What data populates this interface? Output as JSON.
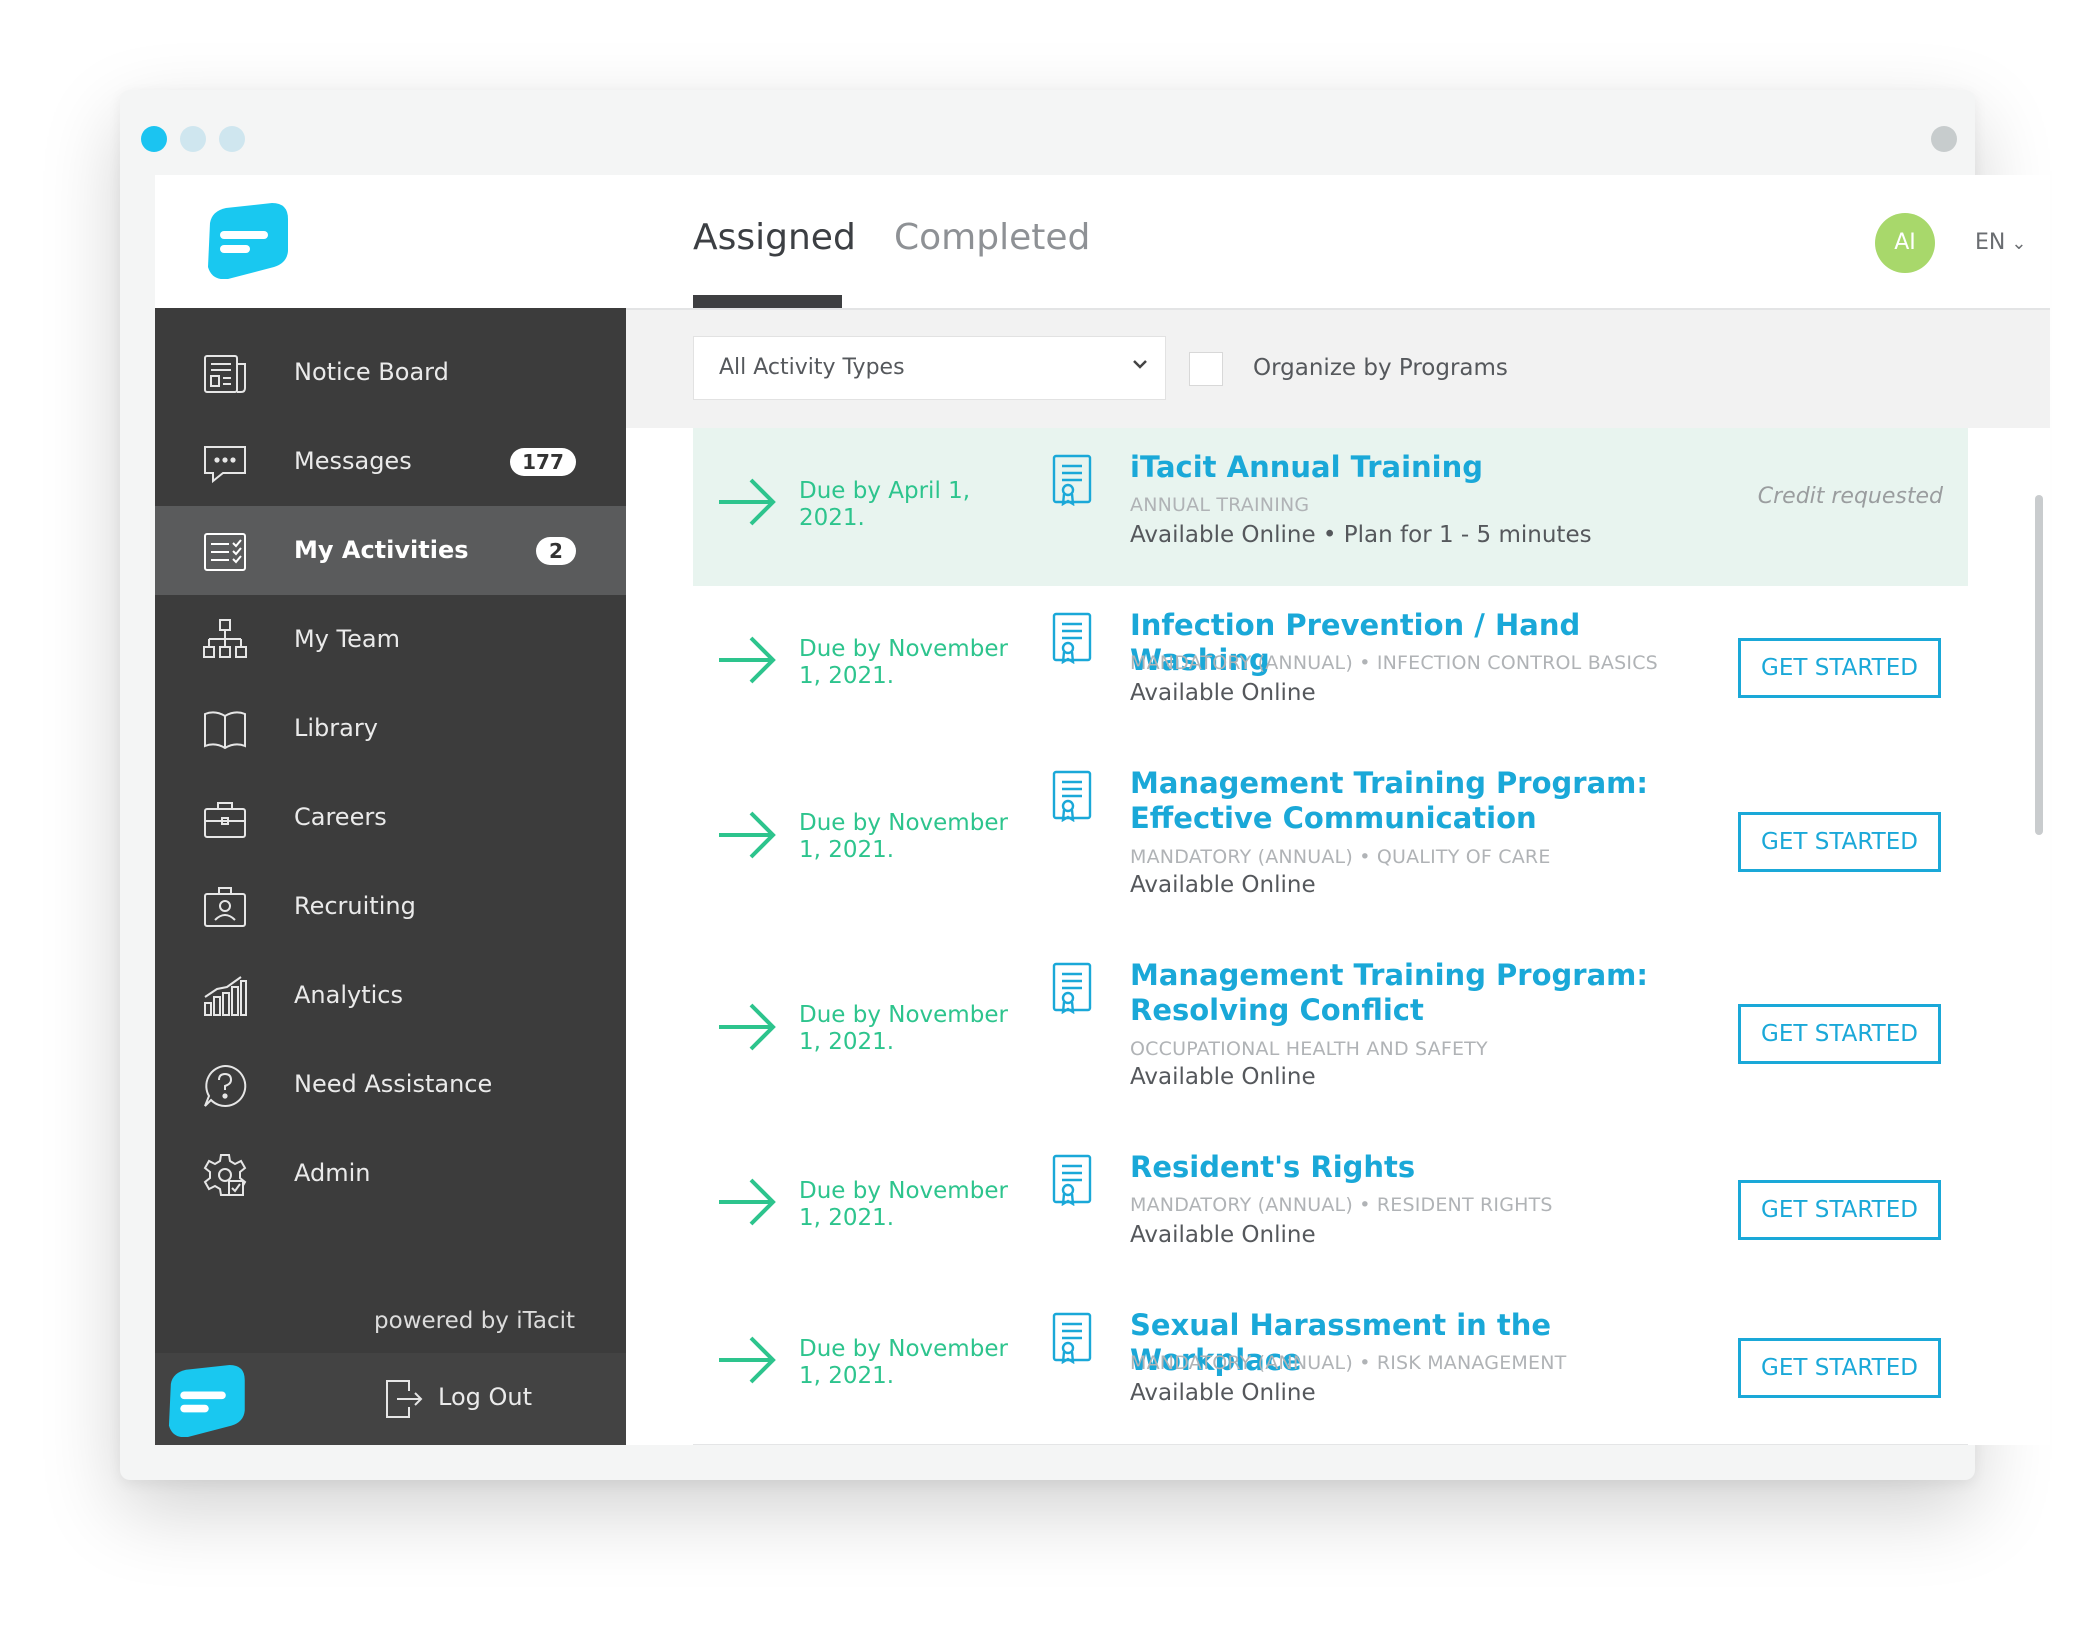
{
  "window_controls": [
    "close",
    "minimize",
    "zoom",
    "menu"
  ],
  "header": {
    "tabs": [
      {
        "label": "Assigned",
        "active": true
      },
      {
        "label": "Completed",
        "active": false
      }
    ],
    "avatar_initials": "AI",
    "language": "EN"
  },
  "sidebar": {
    "items": [
      {
        "label": "Notice Board",
        "icon": "newspaper-icon"
      },
      {
        "label": "Messages",
        "icon": "chat-bubble-icon",
        "badge": "177"
      },
      {
        "label": "My Activities",
        "icon": "checklist-icon",
        "badge": "2",
        "active": true
      },
      {
        "label": "My Team",
        "icon": "org-chart-icon"
      },
      {
        "label": "Library",
        "icon": "book-icon"
      },
      {
        "label": "Careers",
        "icon": "briefcase-icon"
      },
      {
        "label": "Recruiting",
        "icon": "id-badge-icon"
      },
      {
        "label": "Analytics",
        "icon": "bar-chart-icon"
      },
      {
        "label": "Need Assistance",
        "icon": "help-icon"
      },
      {
        "label": "Admin",
        "icon": "gear-icon"
      }
    ],
    "powered_by": "powered by iTacit",
    "logout": "Log Out"
  },
  "filters": {
    "activity_type": "All Activity Types",
    "organize_label": "Organize by Programs",
    "organize_checked": false
  },
  "activities": [
    {
      "due": "Due by April 1, 2021.",
      "title": "iTacit Annual Training",
      "meta": "ANNUAL TRAINING",
      "availability": "Available Online • Plan for 1 - 5 minutes",
      "status": "Credit requested"
    },
    {
      "due": "Due by November 1, 2021.",
      "title": "Infection Prevention / Hand Washing",
      "meta": "MANDATORY (ANNUAL) • INFECTION CONTROL BASICS",
      "availability": "Available Online",
      "action": "GET STARTED"
    },
    {
      "due": "Due by November 1, 2021.",
      "title": "Management Training Program: Effective Communication",
      "meta": "MANDATORY (ANNUAL) • QUALITY OF CARE",
      "availability": "Available Online",
      "action": "GET STARTED"
    },
    {
      "due": "Due by November 1, 2021.",
      "title": "Management Training Program: Resolving Conflict",
      "meta": "OCCUPATIONAL HEALTH AND SAFETY",
      "availability": "Available Online",
      "action": "GET STARTED"
    },
    {
      "due": "Due by November 1, 2021.",
      "title": "Resident's Rights",
      "meta": "MANDATORY (ANNUAL) • RESIDENT RIGHTS",
      "availability": "Available Online",
      "action": "GET STARTED"
    },
    {
      "due": "Due by November 1, 2021.",
      "title": "Sexual Harassment in the Workplace",
      "meta": "MANDATORY (ANNUAL) • RISK MANAGEMENT",
      "availability": "Available Online",
      "action": "GET STARTED"
    }
  ],
  "colors": {
    "accent": "#1aa8d8",
    "due_green": "#2dc48d",
    "sidebar_bg": "#3c3c3c",
    "sidebar_active": "#5a5b5c",
    "credit_row_bg": "#e8f4ef",
    "avatar_bg": "#a8d86b"
  }
}
